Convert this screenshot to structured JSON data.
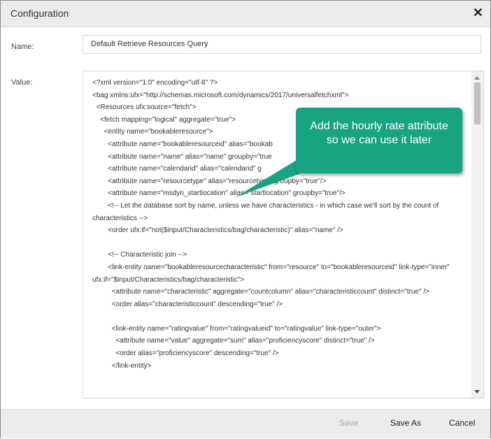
{
  "dialog": {
    "title": "Configuration",
    "close_icon": "close-icon"
  },
  "fields": {
    "name_label": "Name:",
    "name_value": "Default Retrieve Resources Query",
    "value_label": "Value:"
  },
  "code": {
    "lines": [
      "<?xml version=\"1.0\" encoding=\"utf-8\" ?>",
      "<bag xmlns:ufx=\"http://schemas.microsoft.com/dynamics/2017/universalfetchxml\">",
      "  <Resources ufx:source=\"fetch\">",
      "    <fetch mapping=\"logical\" aggregate=\"true\">",
      "      <entity name=\"bookableresource\">",
      "        <attribute name=\"bookableresourceid\" alias=\"bookab",
      "        <attribute name=\"name\" alias=\"name\" groupby=\"true",
      "        <attribute name=\"calendarid\" alias=\"calendarid\" g",
      "        <attribute name=\"resourcetype\" alias=\"resourcetype\" groupby=\"true\"/>",
      "        <attribute name=\"msdyn_startlocation\" alias=\"startlocation\" groupby=\"true\"/>",
      "        <!-- Let the database sort by name, unless we have characteristics - in which case we'll sort by the count of characteristics -->",
      "        <order ufx:if=\"not($input/Characteristics/bag/characteristic)\" alias=\"name\" />",
      "",
      "        <!-- Characteristic join -->",
      "        <link-entity name=\"bookableresourcecharacteristic\" from=\"resource\" to=\"bookableresourceid\" link-type=\"inner\" ufx:if=\"$input/Characteristics/bag/characteristic\">",
      "          <attribute name=\"characteristic\" aggregate=\"countcolumn\" alias=\"characteristiccount\" distinct=\"true\" />",
      "          <order alias=\"characteristiccount\" descending=\"true\" />",
      "",
      "          <link-entity name=\"ratingvalue\" from=\"ratingvalueid\" to=\"ratingvalue\" link-type=\"outer\">",
      "            <attribute name=\"value\" aggregate=\"sum\" alias=\"proficiencyscore\" distinct=\"true\" />",
      "            <order alias=\"proficiencyscore\" descending=\"true\" />",
      "          </link-entity>"
    ]
  },
  "callout": {
    "text": "Add the hourly rate attribute so we can use it later",
    "color": "#18a383"
  },
  "footer": {
    "save_label": "Save",
    "save_as_label": "Save As",
    "cancel_label": "Cancel"
  }
}
